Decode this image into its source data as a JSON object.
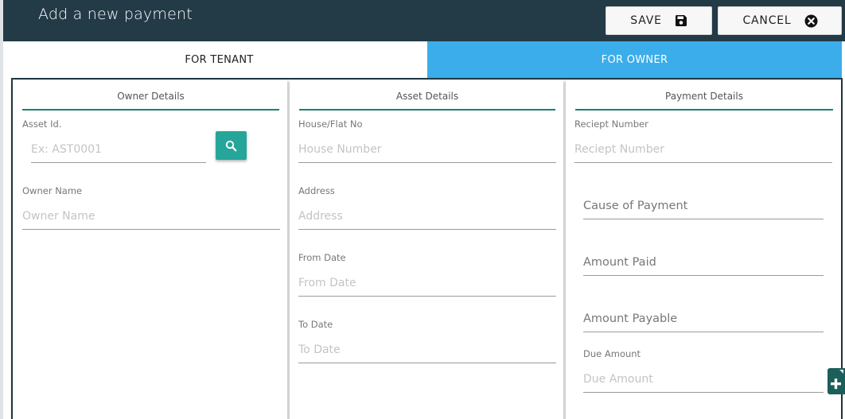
{
  "header": {
    "title": "Add a new payment",
    "save_label": "SAVE",
    "cancel_label": "CANCEL"
  },
  "tabs": [
    {
      "label": "FOR TENANT",
      "active": false
    },
    {
      "label": "FOR OWNER",
      "active": true
    }
  ],
  "owner_details": {
    "title": "Owner Details",
    "asset_id": {
      "label": "Asset Id.",
      "placeholder": "Ex: AST0001",
      "value": ""
    },
    "owner_name": {
      "label": "Owner Name",
      "placeholder": "Owner Name",
      "value": ""
    }
  },
  "asset_details": {
    "title": "Asset Details",
    "house": {
      "label": "House/Flat No",
      "placeholder": "House Number",
      "value": ""
    },
    "address": {
      "label": "Address",
      "placeholder": "Address",
      "value": ""
    },
    "from_date": {
      "label": "From Date",
      "placeholder": "From Date",
      "value": ""
    },
    "to_date": {
      "label": "To Date",
      "placeholder": "To Date",
      "value": ""
    }
  },
  "payment_details": {
    "title": "Payment Details",
    "receipt": {
      "label": "Reciept Number",
      "placeholder": "Reciept Number",
      "value": ""
    },
    "cause": {
      "placeholder": "Cause of Payment",
      "value": ""
    },
    "amount_paid": {
      "placeholder": "Amount Paid",
      "value": ""
    },
    "amount_payable": {
      "placeholder": "Amount Payable",
      "value": ""
    },
    "due_amount": {
      "label": "Due Amount",
      "placeholder": "Due Amount",
      "value": ""
    }
  },
  "icons": {
    "save": "floppy-disk-icon",
    "cancel": "close-circle-icon",
    "search": "search-icon",
    "add": "add-file-icon"
  },
  "colors": {
    "header_bg": "#233a47",
    "active_tab": "#3badea",
    "accent": "#26a69a",
    "divider": "#1f7f73",
    "fab": "#1c5e5a"
  }
}
